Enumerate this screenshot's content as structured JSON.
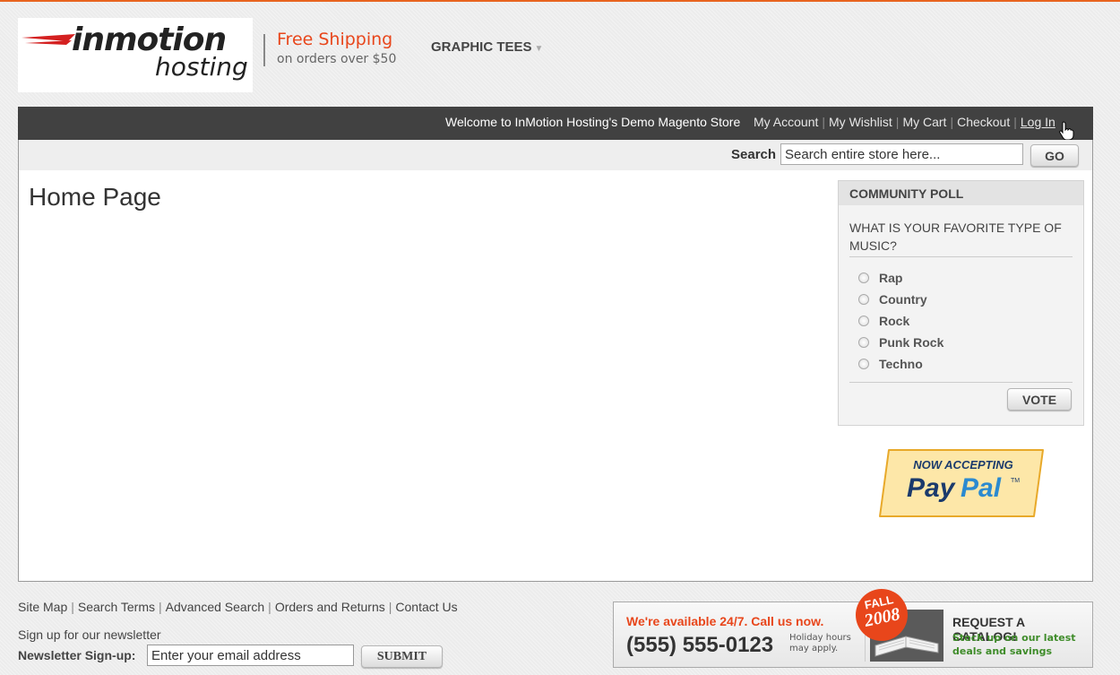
{
  "header": {
    "logo_word1": "inmotion",
    "logo_word2": "hosting",
    "shipping_line1": "Free Shipping",
    "shipping_line2": "on orders over $50",
    "nav_item": "GRAPHIC TEES"
  },
  "topbar": {
    "welcome": "Welcome to InMotion Hosting's Demo Magento Store",
    "links": [
      "My Account",
      "My Wishlist",
      "My Cart",
      "Checkout",
      "Log In"
    ]
  },
  "search": {
    "label": "Search",
    "placeholder": "Search entire store here...",
    "button": "GO"
  },
  "main": {
    "title": "Home Page"
  },
  "poll": {
    "heading": "COMMUNITY POLL",
    "question": "WHAT IS YOUR FAVORITE TYPE OF MUSIC?",
    "options": [
      "Rap",
      "Country",
      "Rock",
      "Punk Rock",
      "Techno"
    ],
    "vote_button": "VOTE"
  },
  "paypal": {
    "line1": "NOW ACCEPTING",
    "line2a": "Pay",
    "line2b": "Pal",
    "tm": "TM"
  },
  "footer": {
    "links": [
      "Site Map",
      "Search Terms",
      "Advanced Search",
      "Orders and Returns",
      "Contact Us"
    ],
    "newsletter_title": "Sign up for our newsletter",
    "newsletter_label": "Newsletter Sign-up:",
    "newsletter_placeholder": "Enter your email address",
    "submit": "SUBMIT"
  },
  "promo": {
    "available": "We're available 24/7. Call us now.",
    "phone": "(555) 555-0123",
    "holiday_1": "Holiday hours",
    "holiday_2": "may apply.",
    "badge_1": "FALL",
    "badge_2": "2008",
    "request": "REQUEST A CATALOG!",
    "stock_1": "Stock up on our latest",
    "stock_2": "deals and savings"
  },
  "colors": {
    "accent": "#e8461b",
    "topbar": "#414141",
    "promo_green": "#3f8c2a"
  }
}
